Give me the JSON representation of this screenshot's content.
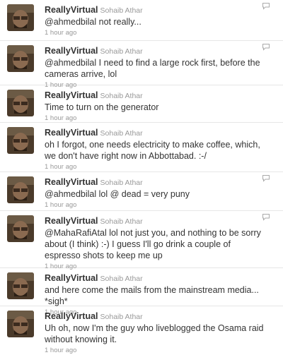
{
  "colors": {
    "text": "#333333",
    "meta": "#999999",
    "divider": "#e6e6e6"
  },
  "tweets": [
    {
      "screen_name": "ReallyVirtual",
      "full_name": "Sohaib Athar",
      "text": "@ahmedbilal not really...",
      "time": "1 hour ago",
      "icon": "reply-icon"
    },
    {
      "screen_name": "ReallyVirtual",
      "full_name": "Sohaib Athar",
      "text": "@ahmedbilal I need to find a large rock first, before the cameras arrive, lol",
      "time": "1 hour ago",
      "icon": "reply-icon"
    },
    {
      "screen_name": "ReallyVirtual",
      "full_name": "Sohaib Athar",
      "text": "Time to turn on the generator",
      "time": "1 hour ago"
    },
    {
      "screen_name": "ReallyVirtual",
      "full_name": "Sohaib Athar",
      "text": "oh I forgot, one needs electricity to make coffee, which, we don't have right now in Abbottabad. :-/",
      "time": "1 hour ago"
    },
    {
      "screen_name": "ReallyVirtual",
      "full_name": "Sohaib Athar",
      "text": "@ahmedbilal lol @ dead = very puny",
      "time": "1 hour ago",
      "icon": "reply-icon"
    },
    {
      "screen_name": "ReallyVirtual",
      "full_name": "Sohaib Athar",
      "text": "@MahaRafiAtal lol not just you, and nothing to be sorry about (I think) :-) I guess I'll go drink a couple of espresso shots to keep me up",
      "time": "1 hour ago",
      "icon": "reply-icon"
    },
    {
      "screen_name": "ReallyVirtual",
      "full_name": "Sohaib Athar",
      "text": "and here come the mails from the mainstream media... *sigh*",
      "time": "1 hour ago"
    },
    {
      "screen_name": "ReallyVirtual",
      "full_name": "Sohaib Athar",
      "text": "Uh oh, now I'm the guy who liveblogged the Osama raid without knowing it.",
      "time": "1 hour ago"
    }
  ]
}
